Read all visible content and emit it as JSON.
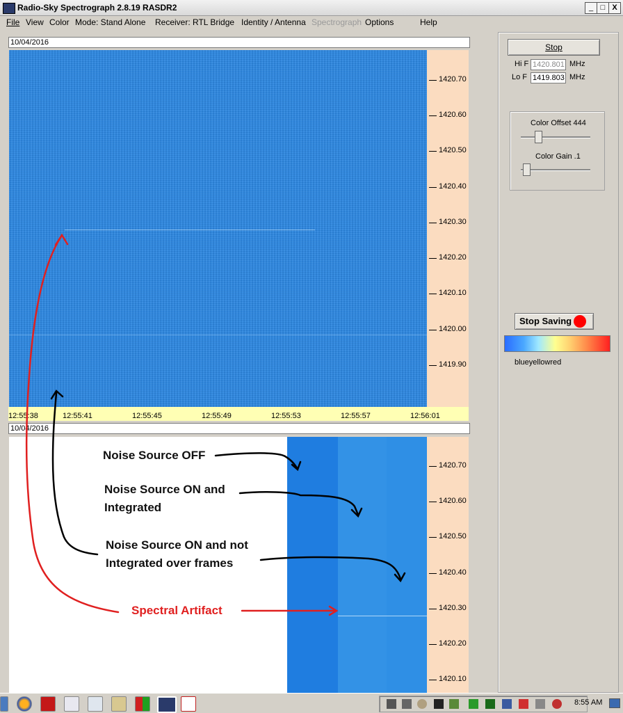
{
  "window": {
    "title": "Radio-Sky Spectrograph  2.8.19  RASDR2",
    "minimize": "_",
    "maximize": "□",
    "close": "X"
  },
  "menu": {
    "file": "File",
    "view": "View",
    "color": "Color",
    "mode": "Mode: Stand Alone",
    "receiver": "Receiver:  RTL Bridge",
    "identity": "Identity / Antenna",
    "spectrograph": "Spectrograph",
    "options": "Options",
    "help": "Help"
  },
  "top_plot": {
    "date": "10/04/2016",
    "freq_ticks": [
      "1420.70",
      "1420.60",
      "1420.50",
      "1420.40",
      "1420.30",
      "1420.20",
      "1420.10",
      "1420.00",
      "1419.90"
    ],
    "time_ticks": [
      "12:55:38",
      "12:55:41",
      "12:55:45",
      "12:55:49",
      "12:55:53",
      "12:55:57",
      "12:56:01"
    ]
  },
  "bottom_plot": {
    "date": "10/04/2016",
    "freq_ticks": [
      "1420.70",
      "1420.60",
      "1420.50",
      "1420.40",
      "1420.30",
      "1420.20",
      "1420.10"
    ]
  },
  "controls": {
    "stop_label": "Stop",
    "hi_f_label": "Hi F",
    "hi_f_value": "1420.801",
    "lo_f_label": "Lo F",
    "lo_f_value": "1419.803",
    "mhz": "MHz",
    "color_offset_label": "Color Offset 444",
    "color_gain_label": "Color Gain .1",
    "color_offset_level": 0.2,
    "color_gain_level": 0.03,
    "stop_saving_label": "Stop Saving",
    "palette_name": "blueyellowred",
    "record_color": "#ff0000"
  },
  "annotations": {
    "noise_off": "Noise Source OFF",
    "noise_on_integrated_1": "Noise Source ON and",
    "noise_on_integrated_2": "Integrated",
    "noise_on_not_integrated_1": "Noise Source ON and not",
    "noise_on_not_integrated_2": "Integrated over frames",
    "spectral_artifact": "Spectral Artifact"
  },
  "taskbar": {
    "clock": "8:55 AM"
  },
  "colors": {
    "spectro_blue": "#2b86e0",
    "freq_panel": "#fbdcc0",
    "time_axis": "#ffffb4",
    "annotation_red": "#e02020"
  }
}
